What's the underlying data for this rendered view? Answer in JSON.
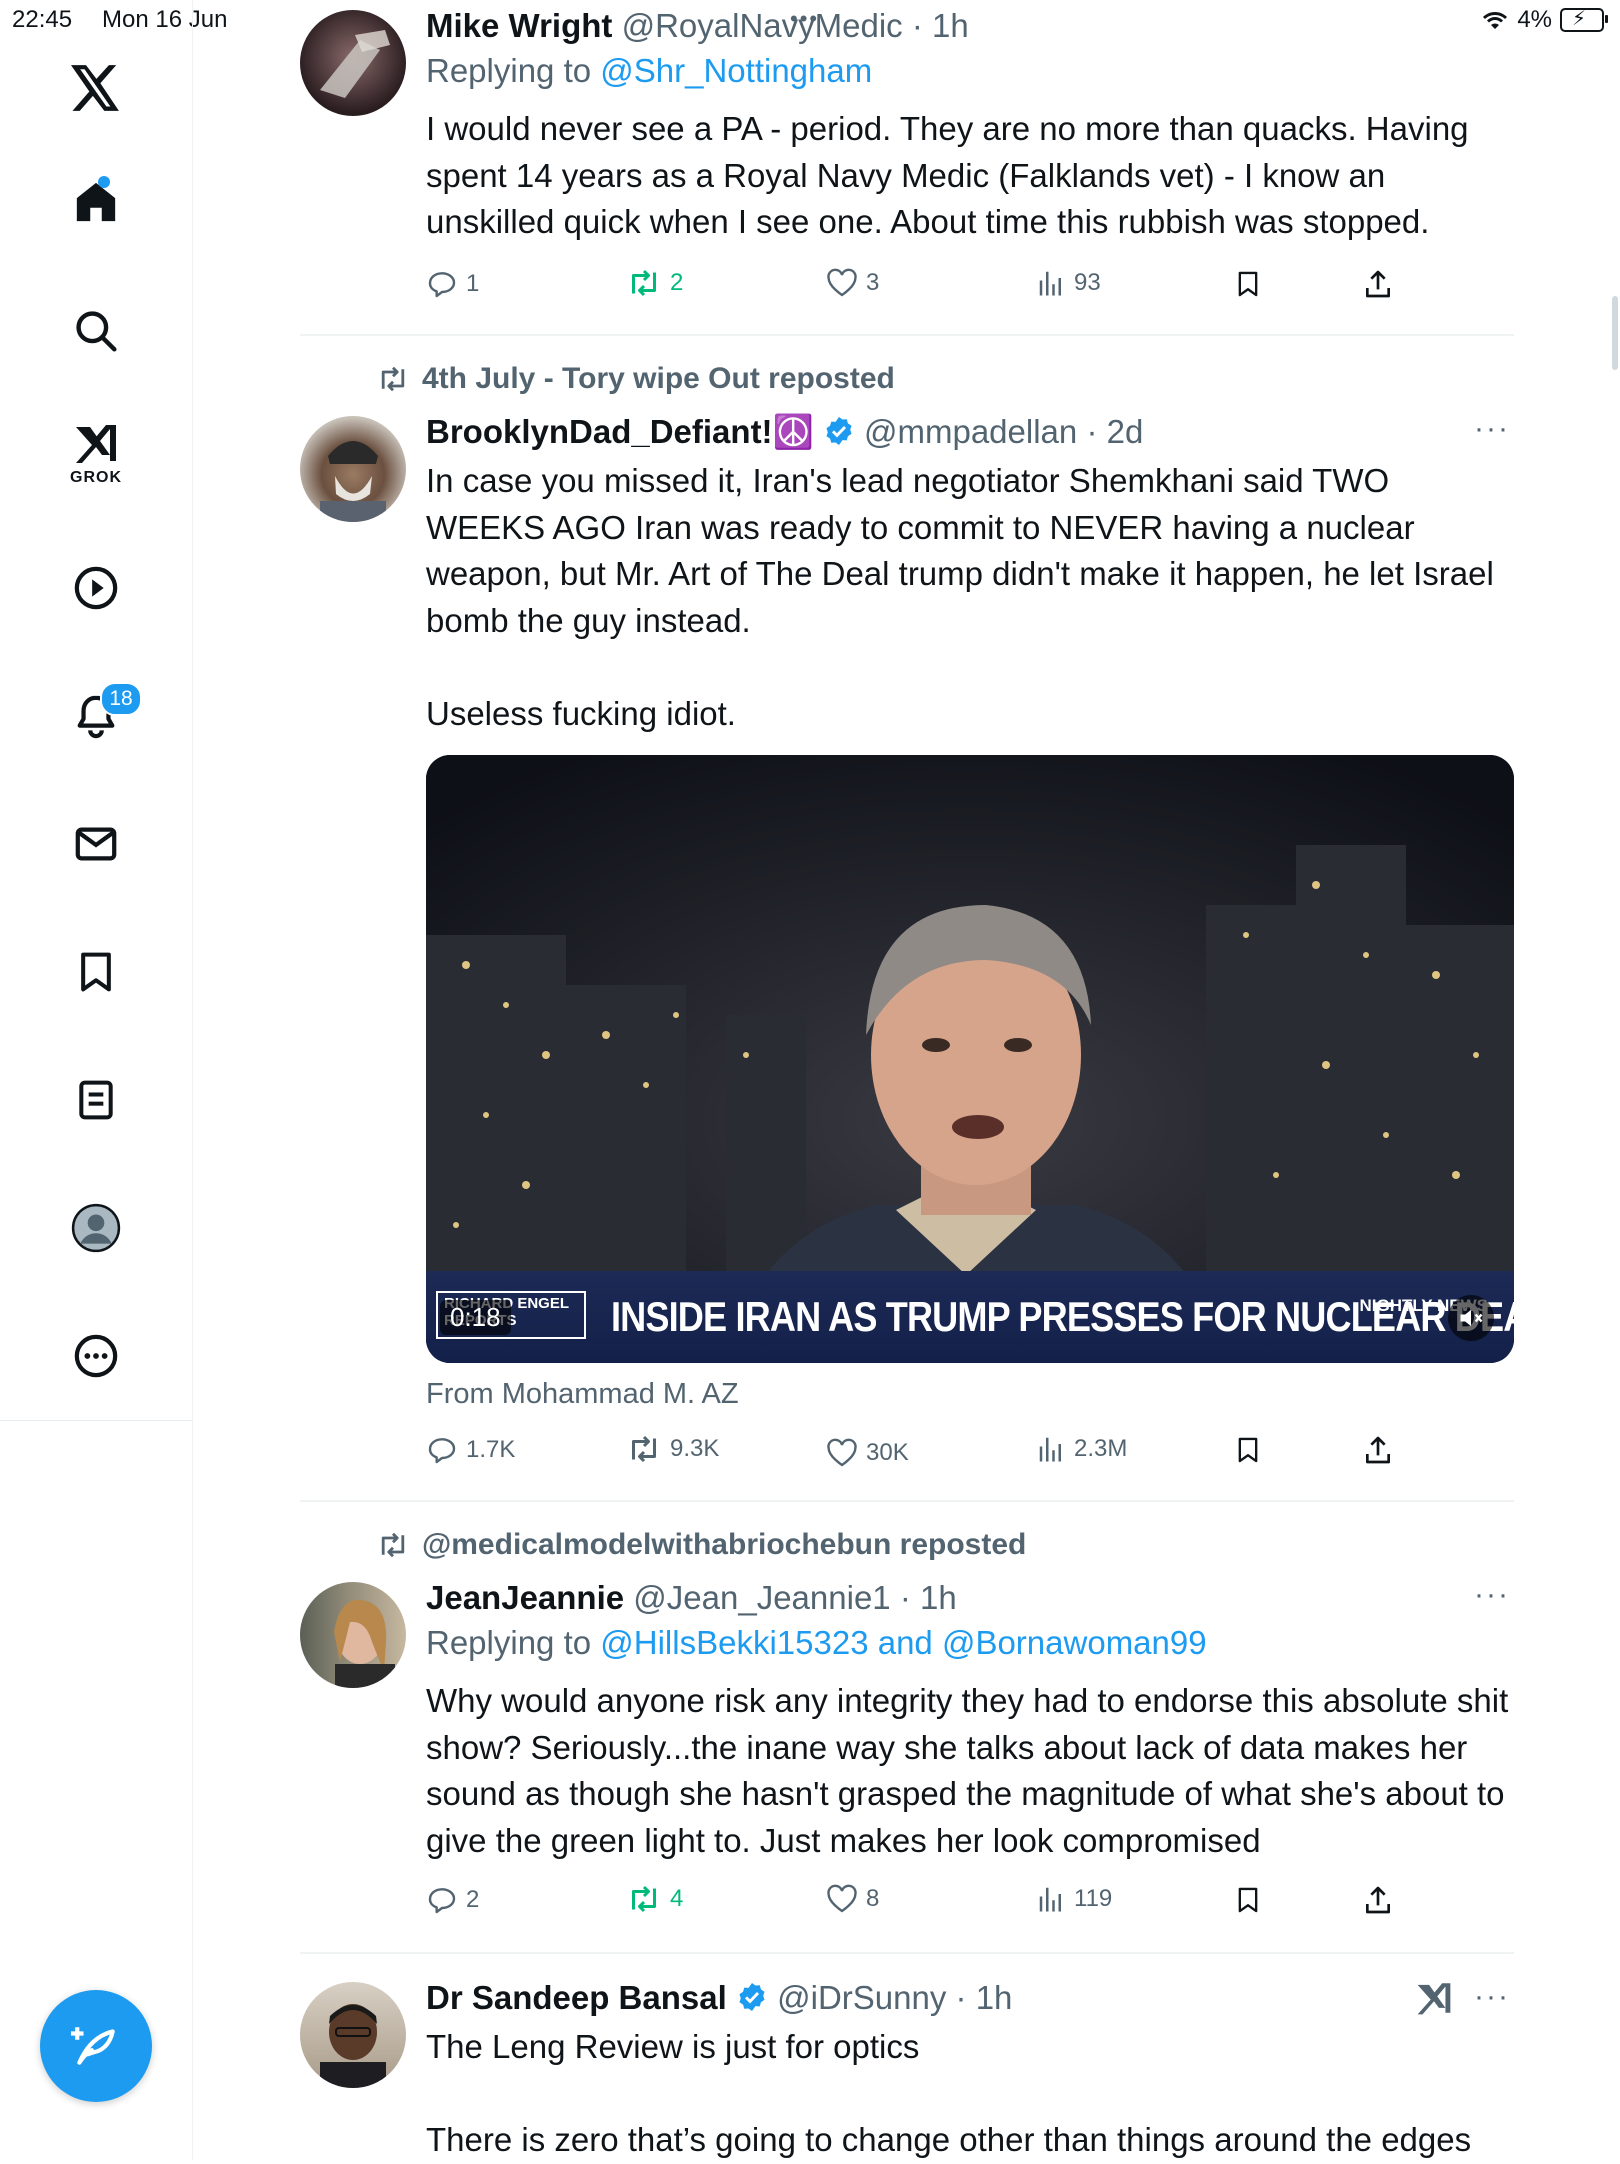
{
  "status_bar": {
    "time": "22:45",
    "date": "Mon 16 Jun",
    "battery": "4%"
  },
  "sidebar": {
    "grok_label": "GROK",
    "notifications_badge": "18",
    "items": [
      "x-logo",
      "home",
      "search",
      "grok",
      "video",
      "notifications",
      "messages",
      "bookmarks",
      "lists",
      "profile",
      "more"
    ]
  },
  "tweets": [
    {
      "name": "Mike Wright",
      "handle": "@RoyalNavyMedic",
      "time": "· 1h",
      "replying_prefix": "Replying to ",
      "replying_to": "@Shr_Nottingham",
      "text": "I would never see a PA - period. They are no more than quacks. Having spent 14 years as a Royal Navy Medic (Falklands vet) - I know an unskilled  quick when I see one. About time this rubbish was stopped.",
      "replies": "1",
      "reposts": "2",
      "likes": "3",
      "views": "93"
    },
    {
      "repost_line": "4th July - Tory wipe Out reposted",
      "name": "BrooklynDad_Defiant!",
      "name_emoji": "☮️",
      "handle": "@mmpadellan",
      "time": "· 2d",
      "text": "In case you missed it, Iran's lead negotiator Shemkhani said TWO WEEKS AGO Iran was ready to commit to NEVER having a nuclear weapon, but Mr. Art of The Deal trump didn't make it happen, he let Israel bomb the guy instead.\n\nUseless fucking idiot.",
      "video": {
        "brand": "RICHARD ENGEL REPORTS",
        "headline": "INSIDE IRAN AS TRUMP PRESSES FOR NUCLEAR DEAL",
        "logo": "NIGHTLY NEWS",
        "timer": "0:18"
      },
      "from": "From Mohammad M. AZ",
      "replies": "1.7K",
      "reposts": "9.3K",
      "likes": "30K",
      "views": "2.3M"
    },
    {
      "repost_line": "@medicalmodelwithabriochebun reposted",
      "name": "JeanJeannie",
      "handle": "@Jean_Jeannie1",
      "time": "· 1h",
      "replying_prefix": "Replying to ",
      "replying_to": "@HillsBekki15323 and @Bornawoman99",
      "text": "Why would anyone risk any integrity they had to endorse this absolute shit show? Seriously...the inane way she talks about lack of data makes her sound as though she hasn't grasped the magnitude of what she's about to give the green light to. Just makes her look compromised",
      "replies": "2",
      "reposts": "4",
      "likes": "8",
      "views": "119"
    },
    {
      "name": "Dr Sandeep Bansal",
      "handle": "@iDrSunny",
      "time": "· 1h",
      "text": "The Leng Review is just for optics\n\nThere is zero that’s going to change other than things around the edges"
    }
  ],
  "more_label": "···",
  "colors": {
    "accent": "#1d9bf0",
    "repost_green": "#00ba7c",
    "muted": "#536471"
  }
}
